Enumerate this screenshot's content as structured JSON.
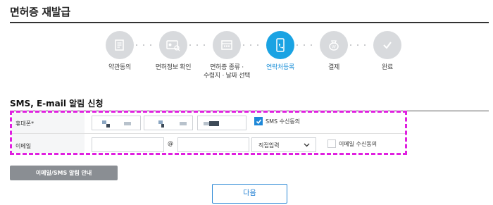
{
  "header": {
    "title": "면허증 재발급"
  },
  "steps": [
    {
      "label": "약관동의",
      "icon": "document-edit-icon",
      "active": false
    },
    {
      "label": "면허정보 확인",
      "icon": "id-card-search-icon",
      "active": false
    },
    {
      "label": "면허증 종류 ·\n수령지 · 날짜 선택",
      "icon": "calendar-icon",
      "active": false
    },
    {
      "label": "연락처등록",
      "icon": "phone-icon",
      "active": true
    },
    {
      "label": "결제",
      "icon": "payment-bag-icon",
      "active": false
    },
    {
      "label": "완료",
      "icon": "checkmark-icon",
      "active": false
    }
  ],
  "section": {
    "title": "SMS, E-mail 알림 신청"
  },
  "form": {
    "phone_label": "휴대폰*",
    "sms_consent_label": "SMS 수신동의",
    "sms_consent_checked": true,
    "email_label": "이메일",
    "at_sign": "@",
    "domain_select_value": "직접입력",
    "email_consent_label": "이메일 수신동의",
    "email_consent_checked": false
  },
  "buttons": {
    "guide": "이메일/SMS 알림 안내",
    "next": "다음"
  },
  "colors": {
    "accent": "#1aa3e3",
    "highlight_border": "#e020e0",
    "inactive_step": "#d8dadd"
  }
}
